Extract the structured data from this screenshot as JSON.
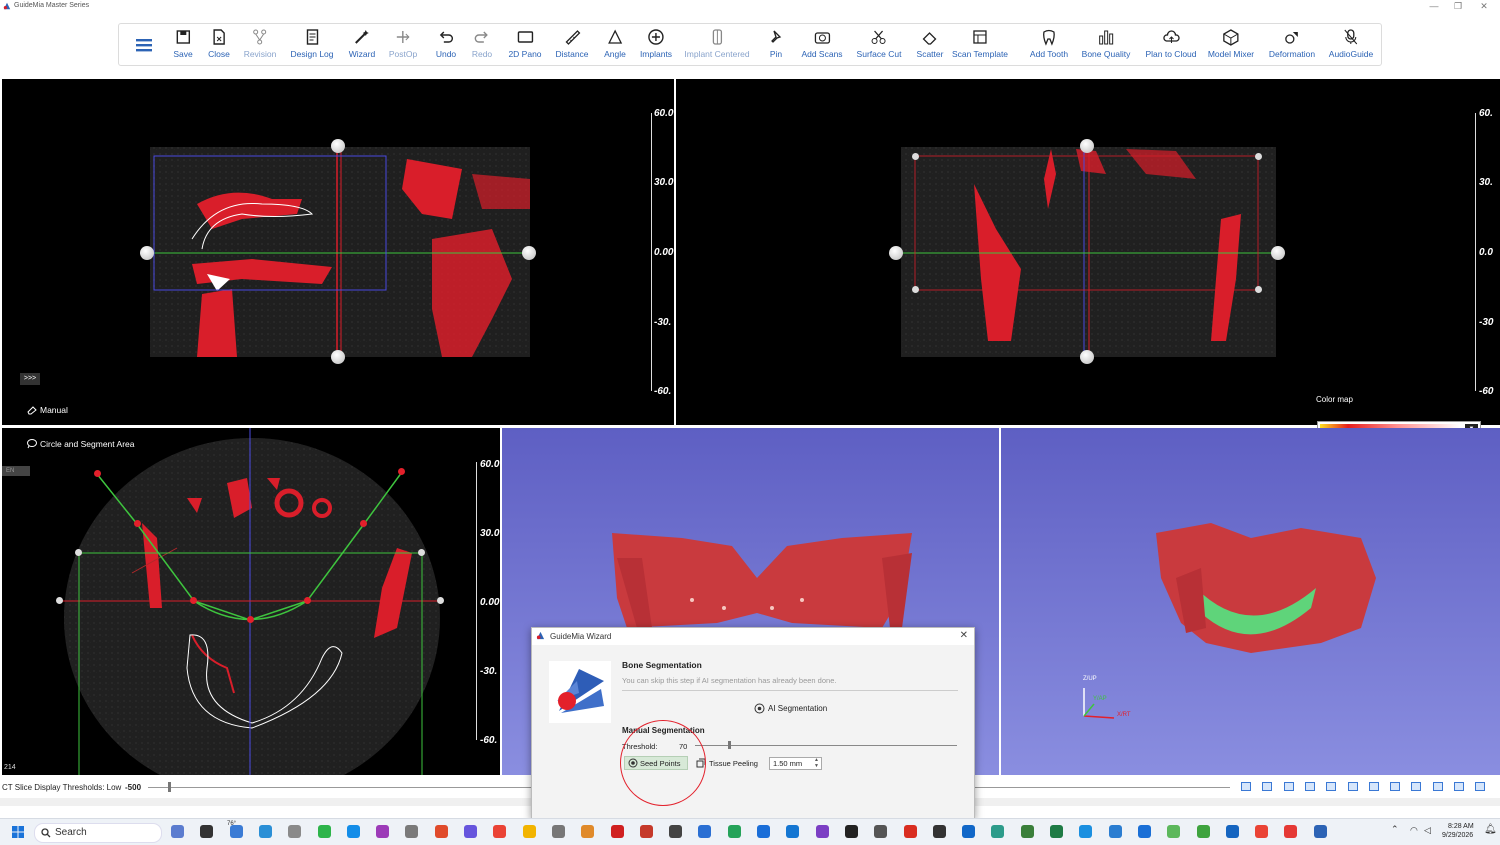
{
  "window": {
    "title": "GuideMia Master Series",
    "minimize": "—",
    "maximize": "❐",
    "close": "✕"
  },
  "toolbar": {
    "menu_label": "menu",
    "buttons": [
      {
        "label": "Save",
        "icon": "save-icon"
      },
      {
        "label": "Close",
        "icon": "close-file-icon"
      },
      {
        "label": "Revision",
        "icon": "revision-icon"
      },
      {
        "label": "Design Log",
        "icon": "design-log-icon"
      },
      {
        "label": "Wizard",
        "icon": "wizard-icon"
      },
      {
        "label": "PostOp",
        "icon": "postop-icon"
      },
      {
        "label": "Undo",
        "icon": "undo-icon"
      },
      {
        "label": "Redo",
        "icon": "redo-icon"
      },
      {
        "label": "2D Pano",
        "icon": "pano-icon"
      },
      {
        "label": "Distance",
        "icon": "distance-icon"
      },
      {
        "label": "Angle",
        "icon": "angle-icon"
      },
      {
        "label": "Implants",
        "icon": "implants-icon"
      },
      {
        "label": "Implant Centered",
        "icon": "implant-centered-icon"
      },
      {
        "label": "Pin",
        "icon": "pin-icon"
      },
      {
        "label": "Add Scans",
        "icon": "add-scans-icon"
      },
      {
        "label": "Surface Cut",
        "icon": "surface-cut-icon"
      },
      {
        "label": "Scatter",
        "icon": "scatter-icon"
      },
      {
        "label": "Scan Template",
        "icon": "scan-template-icon"
      },
      {
        "label": "Add Tooth",
        "icon": "add-tooth-icon"
      },
      {
        "label": "Bone Quality",
        "icon": "bone-quality-icon"
      },
      {
        "label": "Plan to Cloud",
        "icon": "plan-to-cloud-icon"
      },
      {
        "label": "Model Mixer",
        "icon": "model-mixer-icon"
      },
      {
        "label": "Deformation",
        "icon": "deformation-icon"
      },
      {
        "label": "AudioGuide",
        "icon": "audioguide-icon"
      }
    ]
  },
  "viewports": {
    "scale_labels": [
      "60.0",
      "30.0",
      "0.00",
      "-30.",
      "-60."
    ],
    "scale_labels_right": [
      "60.",
      "30.",
      "0.0",
      "-30",
      "-60"
    ],
    "sagittal": {
      "expand": ">>>",
      "mode_label": "Manual"
    },
    "axial": {
      "mode_label": "Circle and Segment Area",
      "slice_number": "214",
      "lang": "EN"
    },
    "color_map": {
      "label": "Color map"
    },
    "axes": {
      "up": "Z/UP",
      "y": "Y/AP",
      "x": "X/RT"
    }
  },
  "ct_slice": {
    "label": "CT Slice Display Thresholds: Low",
    "value": "-500"
  },
  "dialog": {
    "title": "GuideMia Wizard",
    "heading": "Bone Segmentation",
    "subtext": "You can skip this step if AI segmentation has already been done.",
    "ai_button": "AI Segmentation",
    "manual_heading": "Manual Segmentation",
    "threshold_label": "Threshold:",
    "threshold_value": "70",
    "threshold_fraction": 0.13,
    "seed_points": "Seed Points",
    "tissue_peeling": "Tissue Peeling",
    "peel_value": "1.50 mm"
  },
  "taskbar": {
    "search_placeholder": "Search",
    "weather": "76°",
    "time": "8:28 AM",
    "date": "9/29/2026"
  },
  "colors": {
    "accent": "#2c63b5",
    "bone": "#d91e2a",
    "implant_green": "#5fd47a",
    "viewport_3d_top": "#5e5fc3",
    "viewport_3d_bottom": "#8a8ee0"
  }
}
